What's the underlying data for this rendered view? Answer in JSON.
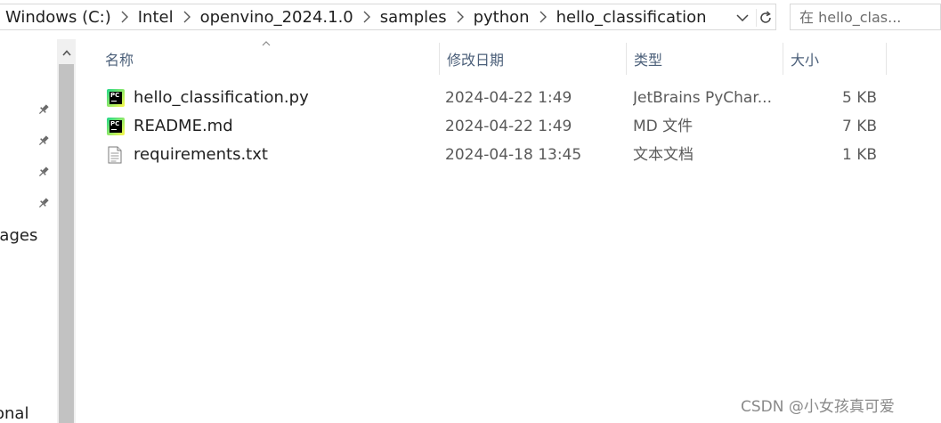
{
  "address_bar": {
    "crumbs": [
      "Windows (C:)",
      "Intel",
      "openvino_2024.1.0",
      "samples",
      "python",
      "hello_classification"
    ]
  },
  "search": {
    "placeholder": "在 hello_clas..."
  },
  "nav": {
    "partial_labels": [
      "nages",
      "onal"
    ]
  },
  "columns": {
    "name": "名称",
    "date": "修改日期",
    "type": "类型",
    "size": "大小"
  },
  "files": [
    {
      "name": "hello_classification.py",
      "date": "2024-04-22 1:49",
      "type": "JetBrains PyChar...",
      "size": "5 KB",
      "icon": "pycharm-icon"
    },
    {
      "name": "README.md",
      "date": "2024-04-22 1:49",
      "type": "MD 文件",
      "size": "7 KB",
      "icon": "pycharm-icon"
    },
    {
      "name": "requirements.txt",
      "date": "2024-04-18 13:45",
      "type": "文本文档",
      "size": "1 KB",
      "icon": "text-file-icon"
    }
  ],
  "watermark": "CSDN @小女孩真可爱",
  "colors": {
    "header_text": "#4c607a",
    "scrollbar_thumb": "#c2c2c2",
    "scrollbar_track": "#f0f0f0"
  }
}
